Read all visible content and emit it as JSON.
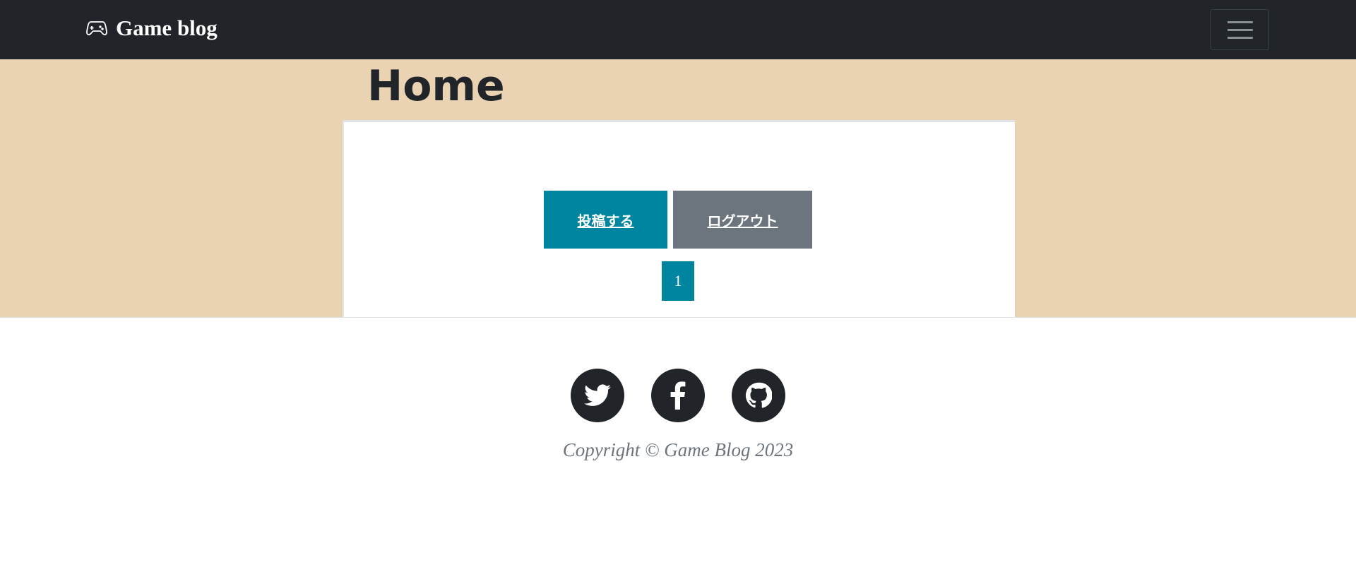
{
  "navbar": {
    "brand": "Game blog",
    "brand_icon": "gamepad-icon",
    "toggler_icon": "hamburger-icon"
  },
  "page": {
    "title": "Home"
  },
  "actions": {
    "post_label": "投稿する",
    "logout_label": "ログアウト"
  },
  "pagination": {
    "current": "1"
  },
  "colors": {
    "primary": "#0085a1",
    "secondary": "#6c757d",
    "navbar": "#212529",
    "hero": "#e9d3b3"
  },
  "footer": {
    "social": [
      "twitter-icon",
      "facebook-icon",
      "github-icon"
    ],
    "copyright": "Copyright © Game Blog 2023"
  }
}
